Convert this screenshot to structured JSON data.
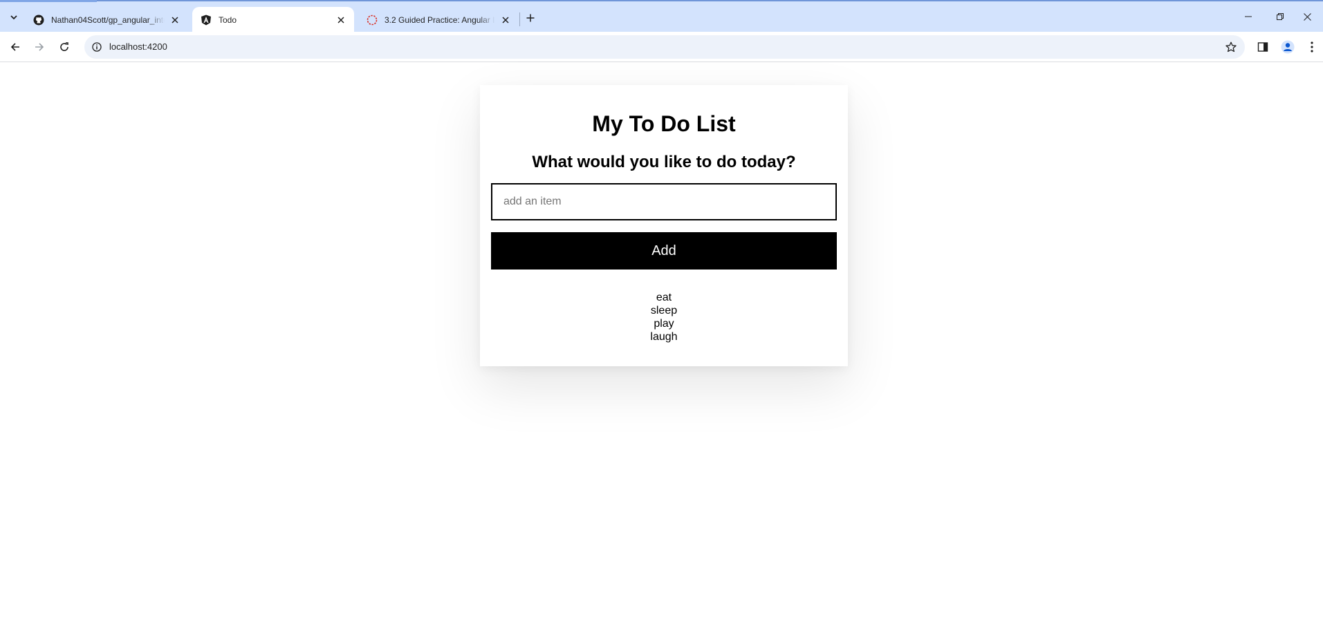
{
  "browser": {
    "tabs": [
      {
        "title": "Nathan04Scott/gp_angular_inte",
        "favicon": "github-icon",
        "active": false
      },
      {
        "title": "Todo",
        "favicon": "angular-icon",
        "active": true
      },
      {
        "title": "3.2 Guided Practice: Angular Int",
        "favicon": "loading-spinner-icon",
        "active": false
      }
    ],
    "address": {
      "url": "localhost:4200"
    }
  },
  "app": {
    "title": "My To Do List",
    "subtitle": "What would you like to do today?",
    "input": {
      "placeholder": "add an item",
      "value": ""
    },
    "add_button_label": "Add",
    "items": [
      "eat",
      "sleep",
      "play",
      "laugh"
    ]
  },
  "colors": {
    "tabstrip_bg": "#d3e3fd",
    "omnibox_bg": "#edf2fa",
    "button_bg": "#000000",
    "button_text": "#ffffff"
  }
}
